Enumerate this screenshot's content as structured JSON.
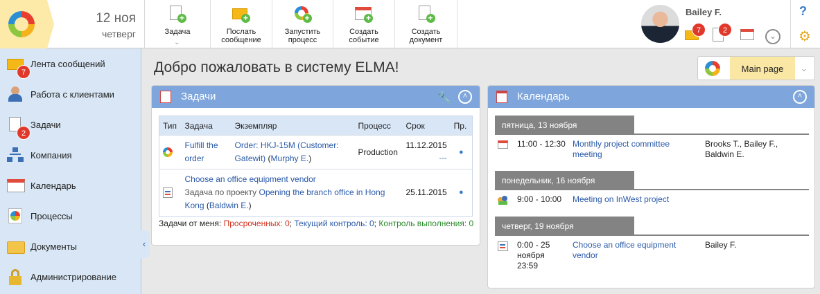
{
  "header": {
    "date_day": "12 ноя",
    "date_weekday": "четверг",
    "toolbar": [
      {
        "label_1": "Задача",
        "label_2": ""
      },
      {
        "label_1": "Послать",
        "label_2": "сообщение"
      },
      {
        "label_1": "Запустить",
        "label_2": "процесс"
      },
      {
        "label_1": "Создать",
        "label_2": "событие"
      },
      {
        "label_1": "Создать",
        "label_2": "документ"
      }
    ],
    "user_name": "Bailey F.",
    "messages_count": "7",
    "tasks_count": "2",
    "help": "?"
  },
  "sidebar": {
    "items": [
      {
        "label": "Лента сообщений",
        "badge": "7"
      },
      {
        "label": "Работа с клиентами"
      },
      {
        "label": "Задачи",
        "badge": "2"
      },
      {
        "label": "Компания"
      },
      {
        "label": "Календарь"
      },
      {
        "label": "Процессы"
      },
      {
        "label": "Документы"
      },
      {
        "label": "Администрирование"
      }
    ]
  },
  "main": {
    "welcome": "Добро пожаловать в систему ELMA!",
    "page_selector": "Main page"
  },
  "tasks": {
    "title": "Задачи",
    "columns": [
      "Тип",
      "Задача",
      "Экземпляр",
      "Процесс",
      "Срок",
      "Пр."
    ],
    "row1": {
      "task": "Fulfill the order",
      "instance": "Order: HKJ-15M (Customer: Gatewit)",
      "instance_person": "Murphy E.",
      "process": "Production",
      "due": "11.12.2015",
      "due_sub": "---"
    },
    "row2": {
      "task": "Choose an office equipment vendor",
      "project_prefix": "Задача по проекту",
      "project": "Opening the branch office in Hong Kong",
      "project_person": "Baldwin E.",
      "due": "25.11.2015"
    },
    "footer": {
      "prefix": "Задачи от меня:",
      "overdue": "Просроченных: 0",
      "current": "Текущий контроль: 0",
      "control": "Контроль выполнения: 0"
    }
  },
  "calendar": {
    "title": "Календарь",
    "days": [
      {
        "label": "пятница, 13 ноября",
        "time": "11:00 - 12:30",
        "title": "Monthly project committee meeting",
        "people": "Brooks T., Bailey F., Baldwin E."
      },
      {
        "label": "понедельник, 16 ноября",
        "time": "9:00 - 10:00",
        "title": "Meeting on InWest project",
        "people": ""
      },
      {
        "label": "четверг, 19 ноября",
        "time": "0:00 - 25 ноября 23:59",
        "title": "Choose an office equipment vendor",
        "people": "Bailey F."
      }
    ]
  },
  "colors": {
    "accent": "#7ea6dc",
    "sidebar": "#d8e6f5",
    "logo_bg": "#fde9a8",
    "badge": "#e0392b"
  }
}
